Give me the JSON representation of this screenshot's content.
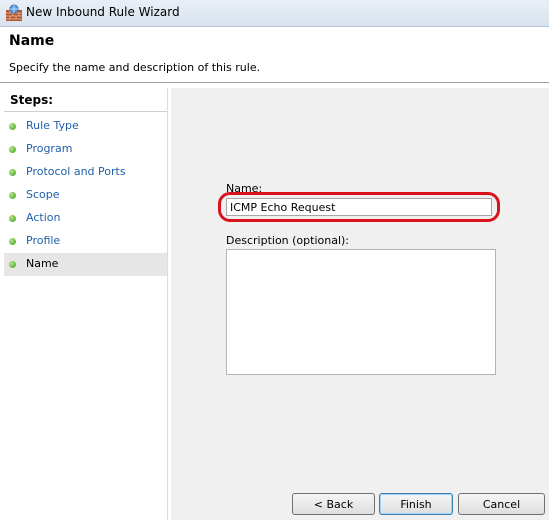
{
  "window": {
    "title": "New Inbound Rule Wizard",
    "icon": "firewall-wizard-icon"
  },
  "header": {
    "title": "Name",
    "description": "Specify the name and description of this rule."
  },
  "steps": {
    "heading": "Steps:",
    "items": [
      {
        "label": "Rule Type"
      },
      {
        "label": "Program"
      },
      {
        "label": "Protocol and Ports"
      },
      {
        "label": "Scope"
      },
      {
        "label": "Action"
      },
      {
        "label": "Profile"
      },
      {
        "label": "Name",
        "current": true
      }
    ]
  },
  "form": {
    "name_label": "Name:",
    "name_value": "ICMP Echo Request",
    "description_label": "Description (optional):",
    "description_value": ""
  },
  "buttons": {
    "back": "< Back",
    "finish": "Finish",
    "cancel": "Cancel"
  },
  "colors": {
    "step_link": "#1f5fa8",
    "highlight": "#d8131b",
    "step_dot": "#3a9b1c"
  }
}
